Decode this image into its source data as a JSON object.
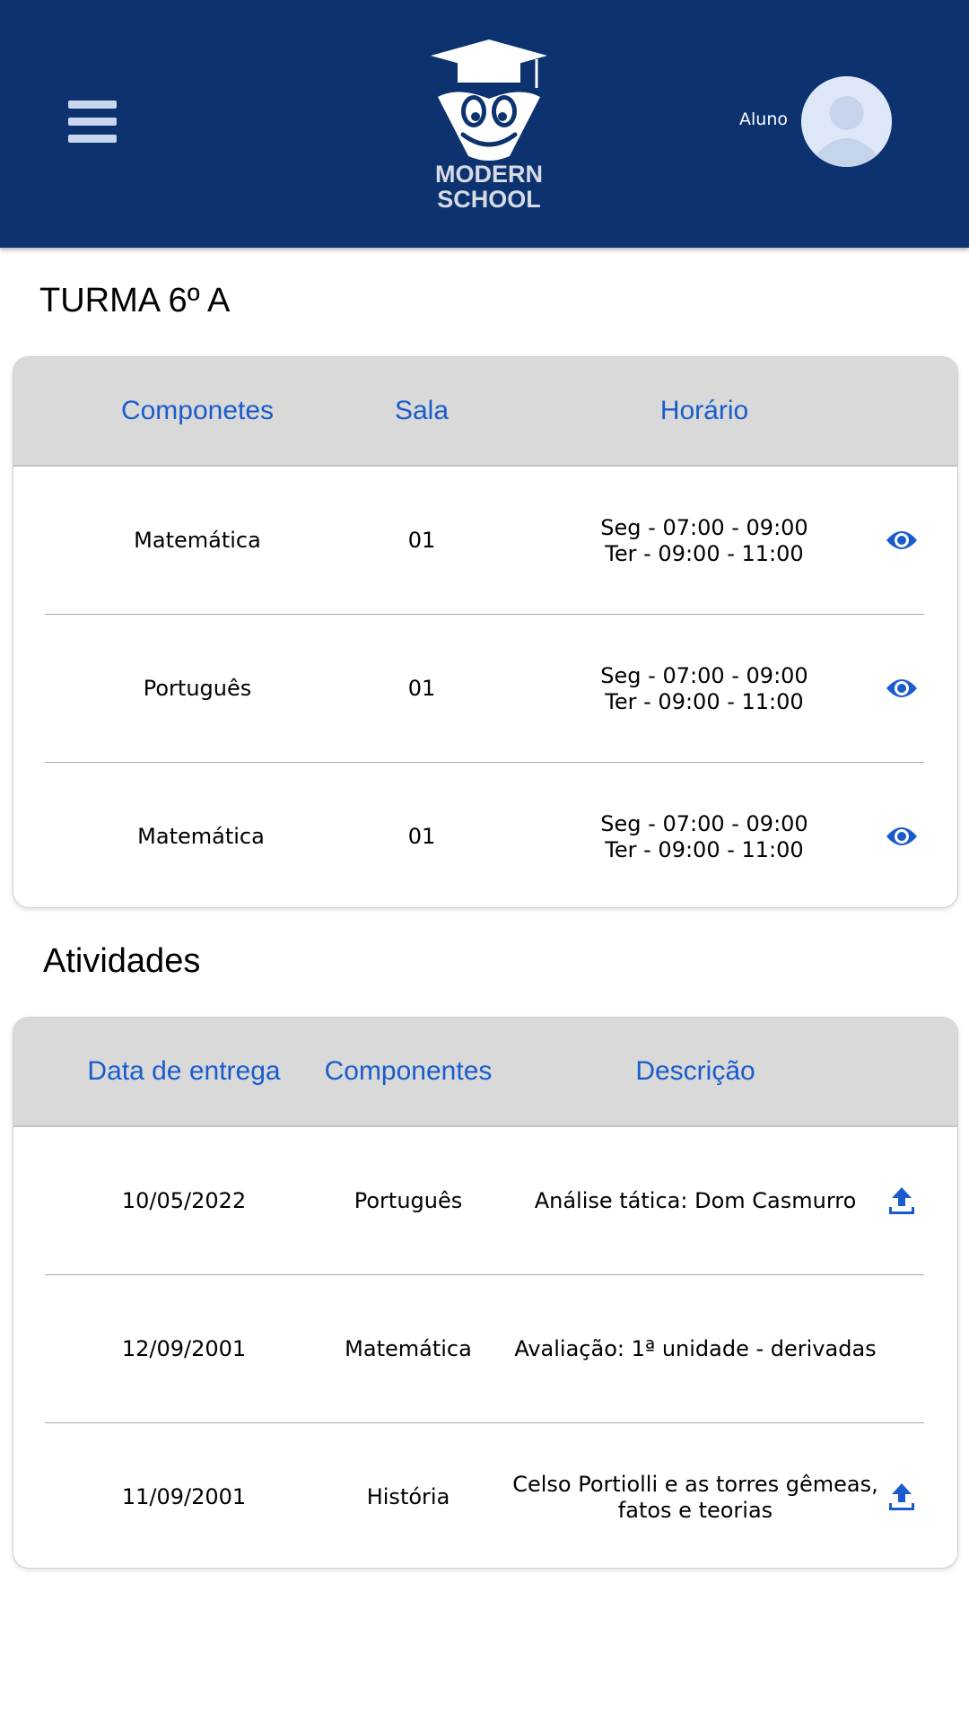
{
  "header": {
    "logo": {
      "line1": "MODERN",
      "line2": "SCHOOL"
    },
    "menu_icon": "hamburger-menu-icon",
    "user": {
      "role": "Aluno",
      "avatar_icon": "user-avatar-icon"
    },
    "colors": {
      "background": "#0c326f",
      "menu": "#c9d8ee",
      "avatar": "#dde7f7"
    }
  },
  "class_section": {
    "title": "TURMA 6º A",
    "columns": [
      "Componetes",
      "Sala",
      "Horário"
    ],
    "rows": [
      {
        "component": "Matemática",
        "room": "01",
        "schedule_line1": "Seg - 07:00 - 09:00",
        "schedule_line2": "Ter - 09:00 - 11:00",
        "action_icon": "eye-icon"
      },
      {
        "component": "Português",
        "room": "01",
        "schedule_line1": "Seg - 07:00 - 09:00",
        "schedule_line2": "Ter - 09:00 - 11:00",
        "action_icon": "eye-icon"
      },
      {
        "component": "Matemática",
        "room": "01",
        "schedule_line1": "Seg - 07:00 - 09:00",
        "schedule_line2": "Ter - 09:00 - 11:00",
        "action_icon": "eye-icon"
      }
    ]
  },
  "activities_section": {
    "title": "Atividades",
    "columns": [
      "Data de entrega",
      "Componentes",
      "Descrição"
    ],
    "rows": [
      {
        "date": "10/05/2022",
        "component": "Português",
        "description_line1": "Análise tática: Dom Casmurro",
        "description_line2": "",
        "action_icon": "upload-icon"
      },
      {
        "date": "12/09/2001",
        "component": "Matemática",
        "description_line1": "Avaliação: 1ª unidade - derivadas",
        "description_line2": "",
        "action_icon": ""
      },
      {
        "date": "11/09/2001",
        "component": "História",
        "description_line1": "Celso Portiolli e as torres gêmeas,",
        "description_line2": "fatos e teorias",
        "action_icon": "upload-icon"
      }
    ]
  },
  "colors": {
    "accent": "#1a5ccc",
    "table_header_bg": "#d9d9d9",
    "divider": "#a9a9a9"
  }
}
